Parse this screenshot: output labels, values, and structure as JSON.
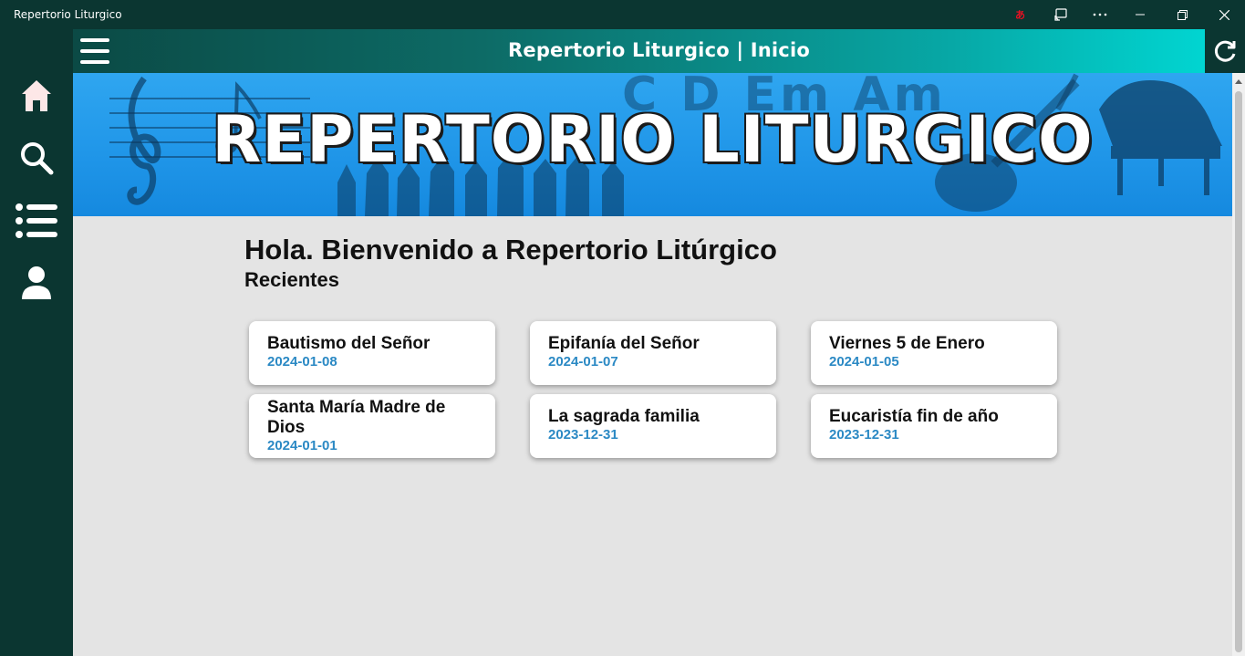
{
  "window": {
    "title": "Repertorio Liturgico",
    "controls": [
      "translate-icon",
      "cast-icon",
      "more-icon",
      "minimize-icon",
      "maximize-icon",
      "close-icon"
    ]
  },
  "sidebar": {
    "items": [
      {
        "name": "home",
        "icon": "home-icon"
      },
      {
        "name": "search",
        "icon": "search-icon"
      },
      {
        "name": "list",
        "icon": "list-icon"
      },
      {
        "name": "profile",
        "icon": "user-icon"
      }
    ]
  },
  "header": {
    "title": "Repertorio Liturgico | Inicio",
    "menu_icon": "hamburger-icon",
    "refresh_icon": "refresh-icon"
  },
  "banner": {
    "text": "REPERTORIO LITURGICO",
    "chords": "C D Em Am"
  },
  "main": {
    "greeting": "Hola. Bienvenido a Repertorio Litúrgico",
    "recent_title": "Recientes",
    "recent": [
      {
        "title": "Bautismo del Señor",
        "date": "2024-01-08"
      },
      {
        "title": "Epifanía del Señor",
        "date": "2024-01-07"
      },
      {
        "title": "Viernes 5 de Enero",
        "date": "2024-01-05"
      },
      {
        "title": "Santa María Madre de Dios",
        "date": "2024-01-01"
      },
      {
        "title": "La sagrada familia",
        "date": "2023-12-31"
      },
      {
        "title": "Eucaristía fin de año",
        "date": "2023-12-31"
      }
    ]
  },
  "colors": {
    "sidebar": "#0b3631",
    "content_bg": "#e4e4e4",
    "date_text": "#2b89c4",
    "banner": "#1f95e8",
    "accent": "#00dcd8"
  }
}
